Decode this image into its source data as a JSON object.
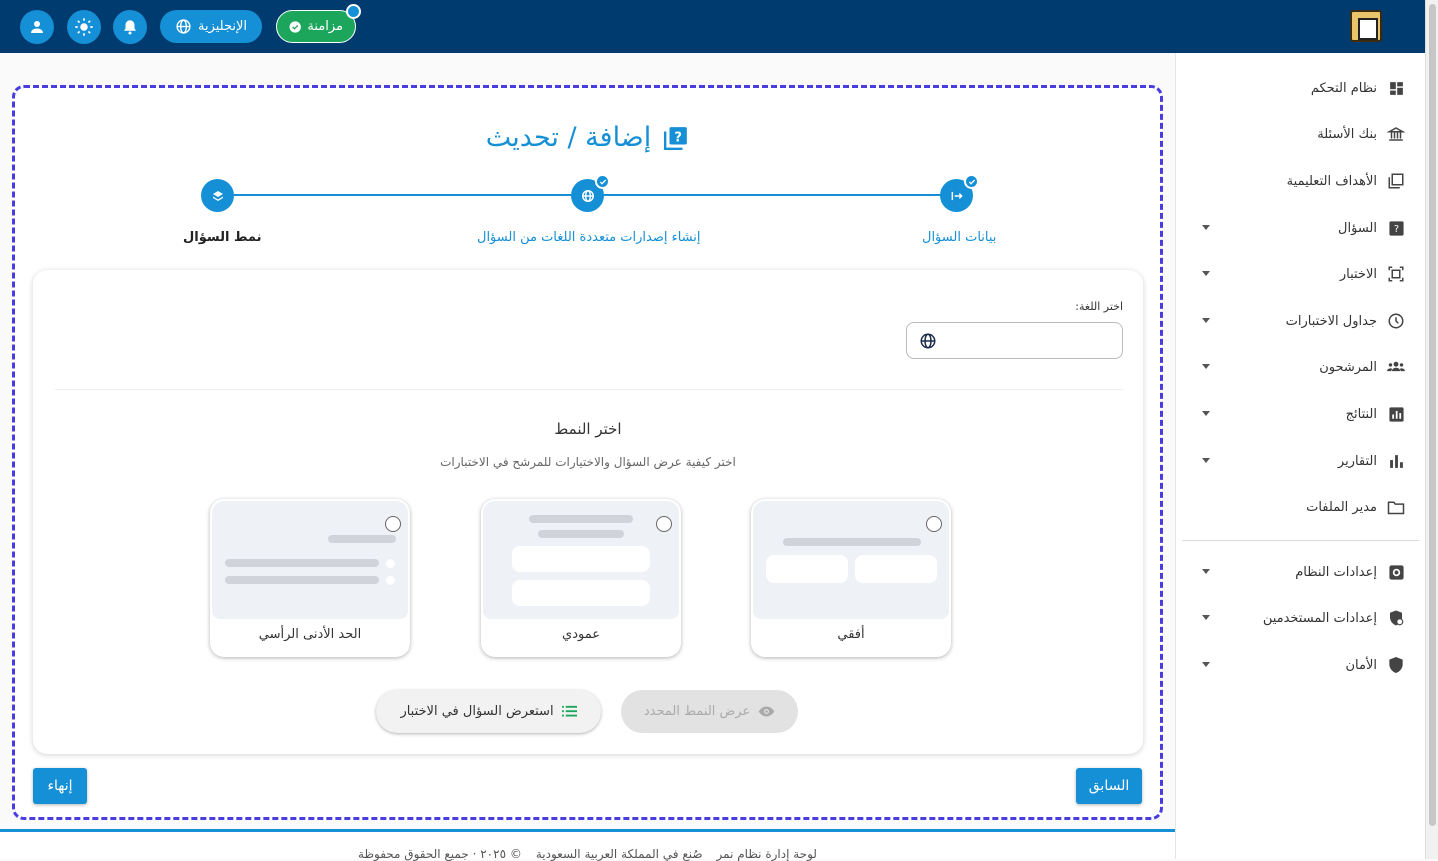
{
  "topbar": {
    "sync_label": "مزامنة",
    "language_label": "الإنجليزية"
  },
  "sidebar": {
    "items": [
      {
        "label": "نظام التحكم",
        "icon": "dashboard-icon"
      },
      {
        "label": "بنك الأسئلة",
        "icon": "bank-icon"
      },
      {
        "label": "الأهداف التعليمية",
        "icon": "objectives-icon"
      },
      {
        "label": "السؤال",
        "icon": "question-icon"
      },
      {
        "label": "الاختبار",
        "icon": "exam-icon"
      },
      {
        "label": "جداول الاختبارات",
        "icon": "clock-icon"
      },
      {
        "label": "المرشحون",
        "icon": "people-icon"
      },
      {
        "label": "النتائج",
        "icon": "results-icon"
      },
      {
        "label": "التقارير",
        "icon": "bar-chart-icon"
      },
      {
        "label": "مدير الملفات",
        "icon": "folder-icon"
      },
      {
        "label": "إعدادات النظام",
        "icon": "settings-icon"
      },
      {
        "label": "إعدادات المستخدمين",
        "icon": "user-security-icon"
      },
      {
        "label": "الأمان",
        "icon": "shield-icon"
      }
    ]
  },
  "page": {
    "title": "إضافة / تحديث",
    "steps": [
      {
        "label": "بيانات السؤال",
        "completed": true
      },
      {
        "label": "إنشاء إصدارات متعددة اللغات من السؤال",
        "completed": true
      },
      {
        "label": "نمط السؤال",
        "active": true
      }
    ],
    "language_label": "اختر اللغة:",
    "section_title": "اختر النمط",
    "section_subtitle": "اختر كيفية عرض السؤال والاختيارات للمرشح في الاختبارات",
    "options": [
      {
        "label": "أفقي"
      },
      {
        "label": "عمودي"
      },
      {
        "label": "الحد الأدنى الرأسي"
      }
    ],
    "preview_button": "استعرض السؤال في الاختبار",
    "show_style_button": "عرض النمط المحدد",
    "finish_button": "إنهاء",
    "previous_button": "السابق"
  },
  "footer": {
    "brand": "لوحة إدارة نظام نمر",
    "made_in": "صُنع في المملكة العربية السعودية",
    "rights": "© ٢٠٢٥ · جميع الحقوق محفوظة"
  },
  "colors": {
    "primary": "#1590d6",
    "topbar": "#003b70",
    "sync": "#1ca65b",
    "frame_border": "#4a3de0"
  }
}
